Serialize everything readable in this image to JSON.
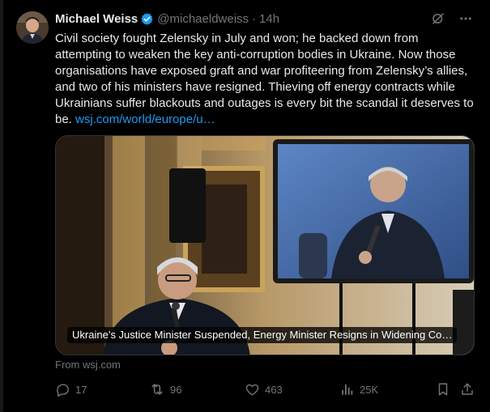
{
  "author": {
    "name": "Michael Weiss",
    "handle": "@michaeldweiss",
    "separator": "·",
    "time": "14h"
  },
  "tweet": {
    "text": "Civil society fought Zelensky in July and won; he backed down from attempting to weaken the key anti-corruption bodies in Ukraine. Now those organisations have exposed graft and war profiteering from Zelensky’s allies, and two of his ministers have resigned. Thieving off energy contracts while Ukrainians suffer blackouts and outages is every bit the scandal it deserves to be.",
    "link": "wsj.com/world/europe/u…"
  },
  "card": {
    "caption": "Ukraine’s Justice Minister Suspended, Energy Minister Resigns in Widening Co…",
    "source": "From wsj.com"
  },
  "actions": {
    "replies": "17",
    "reposts": "96",
    "likes": "463",
    "views": "25K"
  },
  "icons": {
    "verified": "verified-badge-icon",
    "grok": "grok-icon",
    "more": "more-icon",
    "reply": "reply-icon",
    "repost": "repost-icon",
    "like": "heart-icon",
    "views": "views-icon",
    "bookmark": "bookmark-icon",
    "share": "share-icon"
  },
  "colors": {
    "background": "#000000",
    "text": "#e7e9ea",
    "secondary": "#71767b",
    "link": "#1d9bf0",
    "border": "#2f3336"
  }
}
